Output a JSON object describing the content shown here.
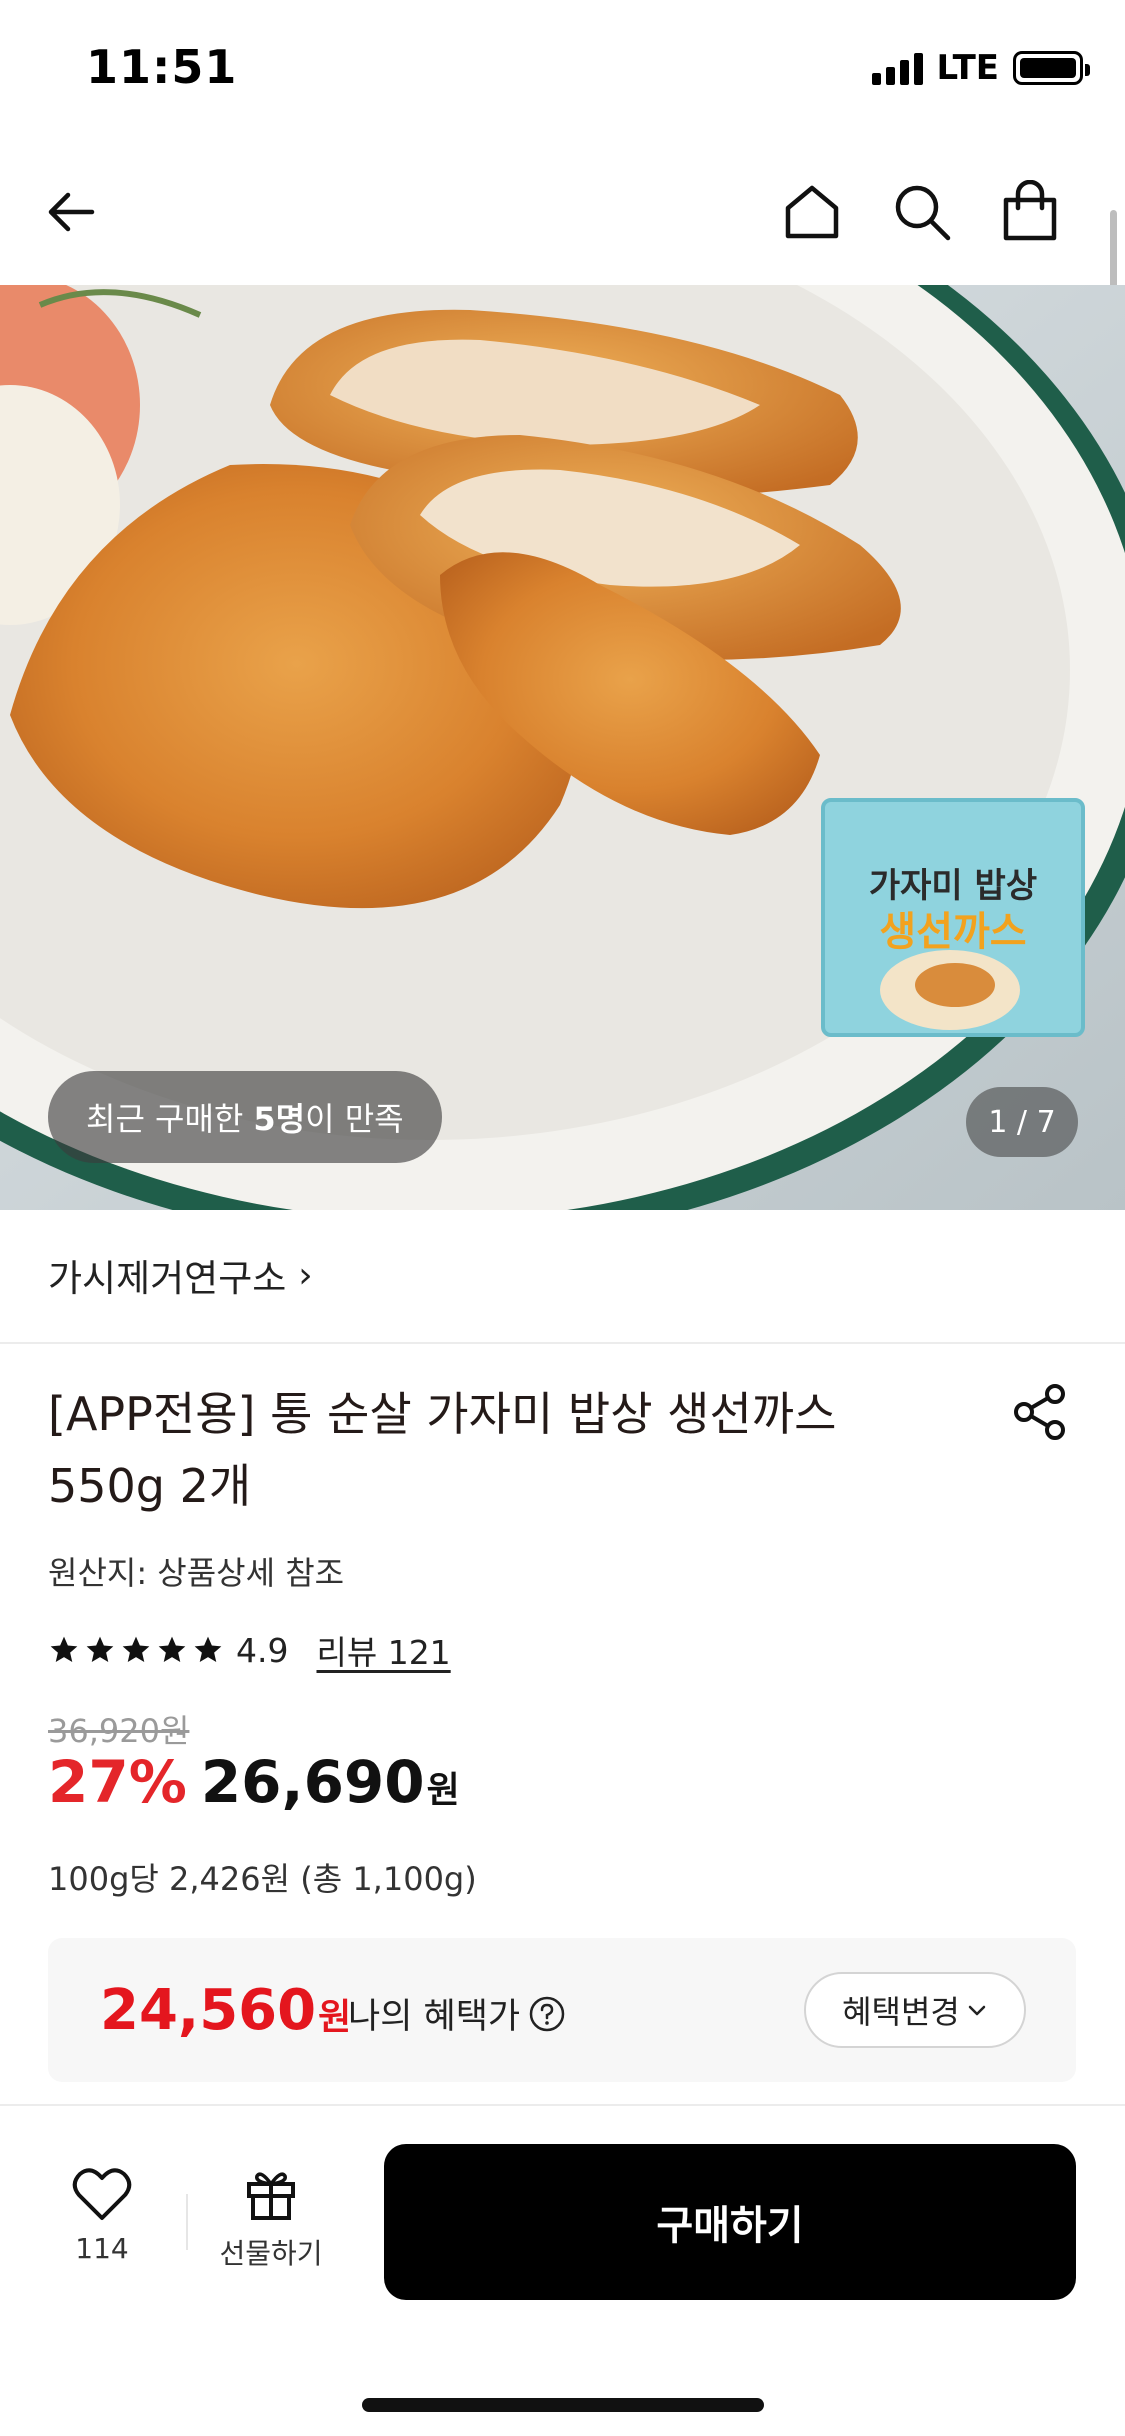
{
  "status_bar": {
    "time": "11:51",
    "network": "LTE"
  },
  "hero": {
    "recent_prefix": "최근 구매한",
    "recent_count": "5명",
    "recent_suffix": "이 만족",
    "page_counter": "1 / 7",
    "package_text_top": "가자미 밥상",
    "package_text_bottom": "생선까스"
  },
  "brand": {
    "name": "가시제거연구소",
    "chevron": "›"
  },
  "product": {
    "title": "[APP전용] 통 순살 가자미 밥상 생선까스 550g 2개",
    "origin": "원산지: 상품상세 참조",
    "rating": "4.9",
    "review_label": "리뷰 121",
    "original_price": "36,920원",
    "discount": "27%",
    "price": "26,690",
    "currency": "원",
    "unit_price": "100g당 2,426원 (총 1,100g)"
  },
  "benefit": {
    "price": "24,560",
    "currency": "원",
    "label": "나의 혜택가",
    "change_button": "혜택변경"
  },
  "bottom_bar": {
    "like_count": "114",
    "gift_label": "선물하기",
    "buy_label": "구매하기"
  },
  "colors": {
    "discount_red": "#e4262a",
    "benefit_red": "#e4161e",
    "buy_button": "#000000"
  },
  "icons": [
    "back-arrow-icon",
    "home-icon",
    "search-icon",
    "shopping-bag-icon",
    "share-icon",
    "star-icon",
    "help-icon",
    "chevron-down-icon",
    "heart-icon",
    "gift-icon"
  ]
}
